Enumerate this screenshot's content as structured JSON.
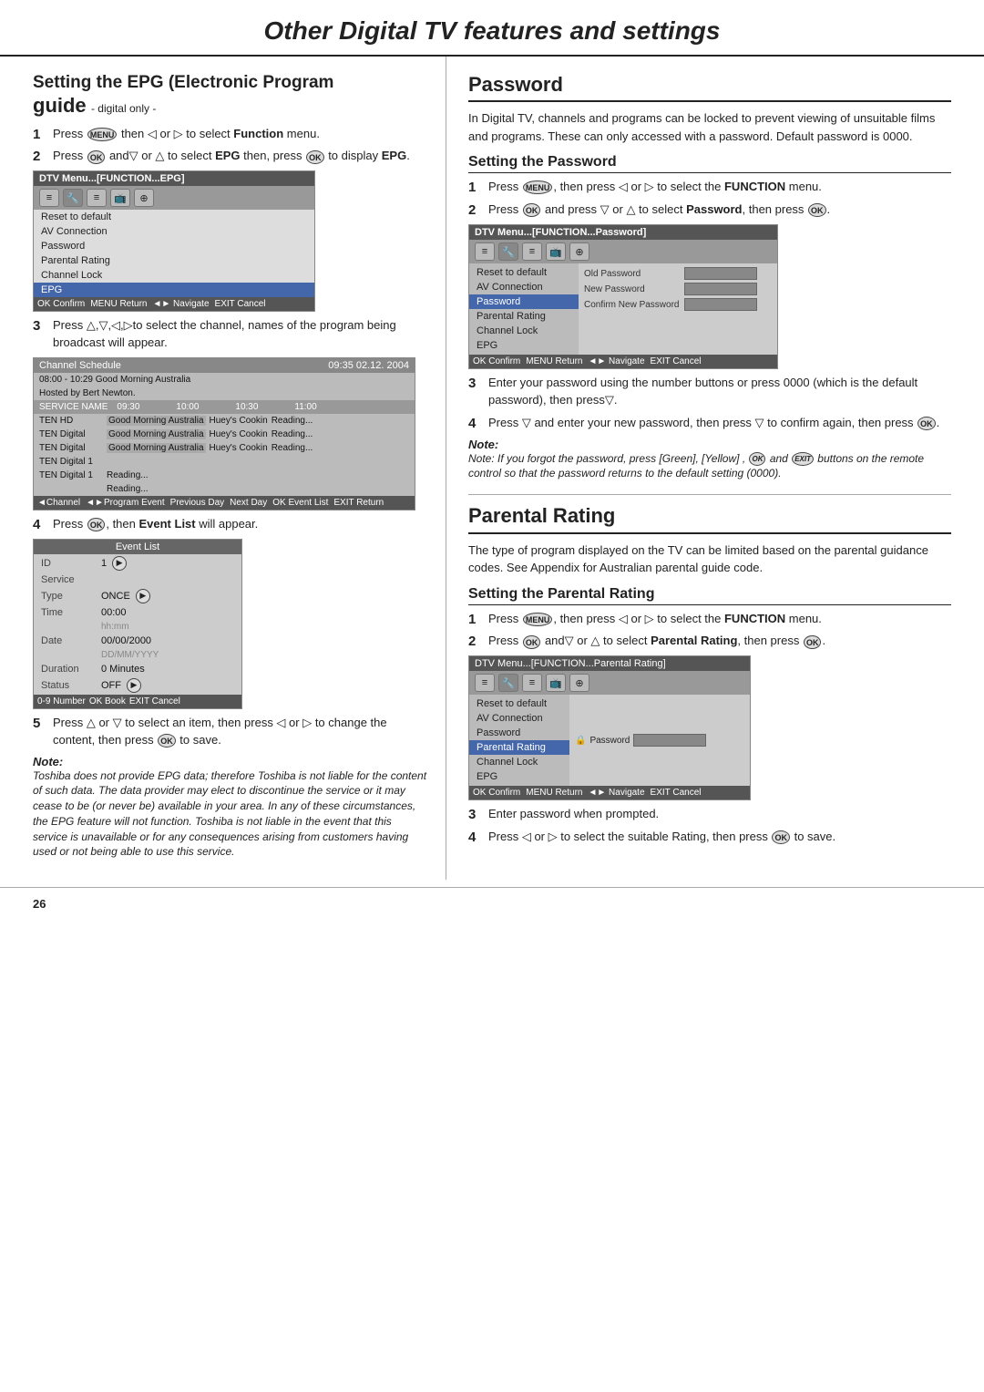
{
  "page": {
    "title": "Other Digital TV features and settings",
    "page_number": "26"
  },
  "left": {
    "section_title": "Setting the EPG (Electronic Program",
    "guide_word": "guide",
    "digital_only": "- digital only -",
    "steps": [
      {
        "num": "1",
        "text": "Press",
        "icon": "MENU",
        "text2": "then ◁ or ▷ to select",
        "bold": "Function",
        "text3": "menu."
      },
      {
        "num": "2",
        "text": "Press",
        "icon": "OK",
        "text2": "and▽ or △ to select",
        "bold": "EPG",
        "text3": "then, press",
        "icon2": "OK",
        "text4": "to display",
        "bold2": "EPG"
      }
    ],
    "menu_box": {
      "titlebar": "DTV Menu...[FUNCTION...EPG]",
      "icons": [
        "≡",
        "🔧",
        "≡",
        "📺",
        "⊕"
      ],
      "items": [
        "Reset to default",
        "AV Connection",
        "Password",
        "Parental Rating",
        "Channel Lock",
        "EPG"
      ],
      "selected": "EPG",
      "footer": "OK Confirm  MENU Return  ◄► Navigate  EXIT Cancel"
    },
    "step3": {
      "num": "3",
      "text": "Press △,▽,◁,▷to select the channel, names of the program being broadcast will appear."
    },
    "schedule_box": {
      "titlebar_left": "Channel Schedule",
      "titlebar_right": "09:35 02.12. 2004",
      "row1": "08:00 - 10:29  Good Morning Australia",
      "row2": "Hosted by Bert Newton.",
      "col_headers": [
        "SERVICE NAME",
        "09:30",
        "10:00",
        "10:30",
        "11:00"
      ],
      "rows": [
        [
          "TEN HD",
          "Good Morning Australia",
          "",
          "Huey's Cookin",
          "Reading..."
        ],
        [
          "TEN Digital",
          "Good Morning Australia",
          "",
          "Huey's Cookin",
          "Reading..."
        ],
        [
          "TEN Digital",
          "Good Morning Australia",
          "",
          "Huey's Cookin",
          "Reading..."
        ],
        [
          "TEN Digital 1",
          "",
          "",
          "",
          ""
        ],
        [
          "TEN Digital 1",
          "Reading...",
          "",
          "",
          ""
        ],
        [
          "",
          "Reading...",
          "",
          "",
          ""
        ]
      ],
      "footer": "◄Channel  ◄►Program Event  Previous Day  Next Day  OK Event List  EXIT Return"
    },
    "step4": {
      "num": "4",
      "text": "Press",
      "icon": "OK",
      "text2": ", then",
      "bold": "Event List",
      "text3": "will appear."
    },
    "eventlist_box": {
      "titlebar": "Event List",
      "rows": [
        {
          "label": "ID",
          "val": "1",
          "arrow": "▶"
        },
        {
          "label": "Service",
          "val": ""
        },
        {
          "label": "Type",
          "val": "ONCE",
          "arrow": "▶"
        },
        {
          "label": "Time",
          "val": "00:00"
        },
        {
          "label": "",
          "val": "hh:mm"
        },
        {
          "label": "Date",
          "val": "00/00/2000"
        },
        {
          "label": "",
          "val": "DD/MM/YYYY"
        },
        {
          "label": "Duration",
          "val": "0  Minutes"
        },
        {
          "label": "Status",
          "val": "OFF",
          "arrow": "▶"
        }
      ],
      "footer": "0-9 Number  OK Book  EXIT Cancel"
    },
    "step5": {
      "num": "5",
      "text": "Press △ or ▽ to select an item, then press ◁ or ▷ to change the content, then press",
      "icon": "OK",
      "text2": "to save."
    },
    "note": {
      "label": "Note:",
      "text": "Toshiba does not provide EPG data; therefore Toshiba is not liable for the content of such data. The data provider may elect to discontinue the service or it may cease to be (or never be) available in your area. In any of these circumstances, the EPG feature will not function. Toshiba is not liable in the event that this service is unavailable or for any consequences arising from customers having used or not being able to use this service."
    }
  },
  "right": {
    "password_section": {
      "title": "Password",
      "intro": "In Digital TV, channels and programs can be locked to prevent viewing of unsuitable films and programs. These can only accessed with a password. Default password is 0000.",
      "setting_title": "Setting the Password",
      "steps": [
        {
          "num": "1",
          "text": "Press",
          "icon": "MENU",
          "text2": ", then press ◁ or ▷ to select the",
          "bold": "FUNCTION",
          "text3": "menu."
        },
        {
          "num": "2",
          "text": "Press",
          "icon": "OK",
          "text2": "and press ▽ or △ to select",
          "bold": "Password",
          "text3": ", then press",
          "icon2": "OK"
        }
      ],
      "menu_box": {
        "titlebar": "DTV Menu...[FUNCTION...Password]",
        "icons": [
          "≡",
          "🔧",
          "≡",
          "📺",
          "⊕"
        ],
        "items": [
          "Reset to default",
          "AV Connection",
          "Password",
          "Parental Rating",
          "Channel Lock",
          "EPG"
        ],
        "selected": "Password",
        "fields": [
          {
            "label": "Old Password",
            "val": ""
          },
          {
            "label": "New Password",
            "val": ""
          },
          {
            "label": "Confirm New Password",
            "val": ""
          }
        ],
        "footer": "OK Confirm  MENU Return  ◄► Navigate  EXIT Cancel"
      },
      "step3": {
        "num": "3",
        "text": "Enter your password using the number buttons or press 0000 (which is the default password), then press▽."
      },
      "step4": {
        "num": "4",
        "text": "Press ▽ and enter your new password, then press ▽ to confirm again, then press",
        "icon": "OK"
      },
      "note": {
        "label": "Note:",
        "text": "Note: If you forgot the password, press [Green], [Yellow] , OK and EXIT buttons on the remote control  so that the password returns to the default setting (0000)."
      }
    },
    "parental_section": {
      "title": "Parental Rating",
      "intro": "The type of program displayed on the TV can be limited based on the parental guidance codes. See Appendix for Australian parental guide code.",
      "setting_title": "Setting the Parental Rating",
      "steps": [
        {
          "num": "1",
          "text": "Press",
          "icon": "MENU",
          "text2": ", then press ◁ or ▷ to select the",
          "bold": "FUNCTION",
          "text3": "menu."
        },
        {
          "num": "2",
          "text": "Press",
          "icon": "OK",
          "text2": "and▽ or △ to select",
          "bold": "Parental Rating",
          "text3": ", then press",
          "icon2": "OK"
        }
      ],
      "menu_box": {
        "titlebar": "DTV Menu...[FUNCTION...Parental Rating]",
        "icons": [
          "≡",
          "🔧",
          "≡",
          "📺",
          "⊕"
        ],
        "items": [
          "Reset to default",
          "AV Connection",
          "Password",
          "Parental Rating",
          "Channel Lock",
          "EPG"
        ],
        "selected": "Parental Rating",
        "field_label": "Password",
        "footer": "OK Confirm  MENU Return  ◄► Navigate  EXIT Cancel"
      },
      "step3": {
        "num": "3",
        "text": "Enter password when prompted."
      },
      "step4": {
        "num": "4",
        "text": "Press ◁ or ▷ to select the suitable Rating, then press",
        "icon": "OK",
        "text2": "to save."
      }
    }
  }
}
